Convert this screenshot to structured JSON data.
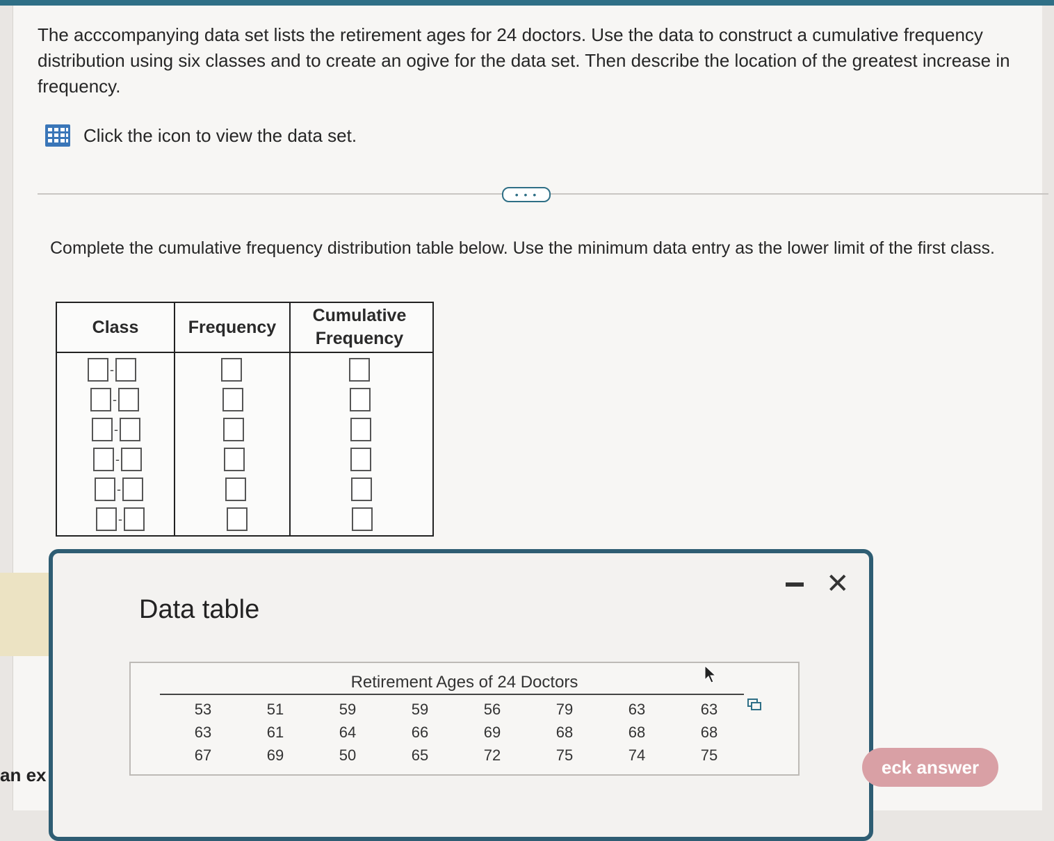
{
  "question": {
    "prompt": "The acccompanying data set lists the retirement ages for 24 doctors. Use the data to construct a cumulative frequency distribution using six classes and to create an ogive for the data set. Then describe the location of the greatest increase in frequency.",
    "data_link_text": "Click the icon to view the data set.",
    "more_label": "• • •",
    "instruction": "Complete the cumulative frequency distribution table below. Use the minimum data entry as the lower limit of the first class."
  },
  "freq_table": {
    "headers": {
      "class": "Class",
      "frequency": "Frequency",
      "cumulative": "Cumulative Frequency"
    },
    "rows": 6
  },
  "modal": {
    "title": "Data table",
    "caption": "Retirement Ages of 24 Doctors",
    "rows": [
      [
        "53",
        "51",
        "59",
        "59",
        "56",
        "79",
        "63",
        "63"
      ],
      [
        "63",
        "61",
        "64",
        "66",
        "69",
        "68",
        "68",
        "68"
      ],
      [
        "67",
        "69",
        "50",
        "65",
        "72",
        "75",
        "74",
        "75"
      ]
    ]
  },
  "footer": {
    "left_text": "an ex",
    "check_answer": "eck answer"
  },
  "colors": {
    "accent": "#2f6f86",
    "button": "#d9a0a5"
  }
}
